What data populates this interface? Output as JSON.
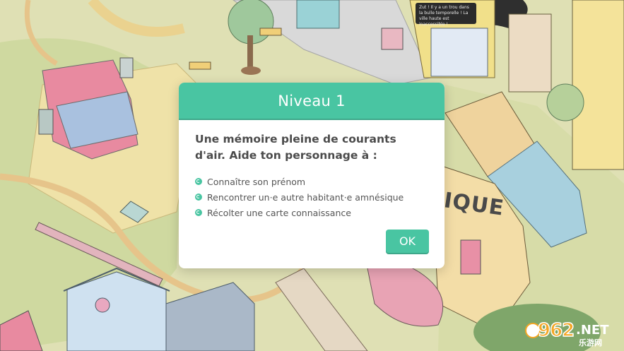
{
  "scene": {
    "speech_bubble": "Zut ! Il y a un trou dans la bulle temporelle ! La ville haute est inaccessible !",
    "shop_sign": "IQUE",
    "watermark": {
      "number": "962",
      "suffix": ".NET",
      "site": "乐游网"
    }
  },
  "dialog": {
    "title": "Niveau 1",
    "description": "Une mémoire pleine de courants d'air. Aide ton personnage à :",
    "objectives": [
      "Connaître son prénom",
      "Rencontrer un·e autre habitant·e amnésique",
      "Récolter une carte connaissance"
    ],
    "ok_label": "OK"
  },
  "colors": {
    "accent": "#49c5a2",
    "accent_dark": "#3ea78a",
    "text": "#4b4b4b"
  },
  "icons": {
    "objective_bullet": "swirl-bullet-icon",
    "watermark_logo": "globe-icon"
  }
}
